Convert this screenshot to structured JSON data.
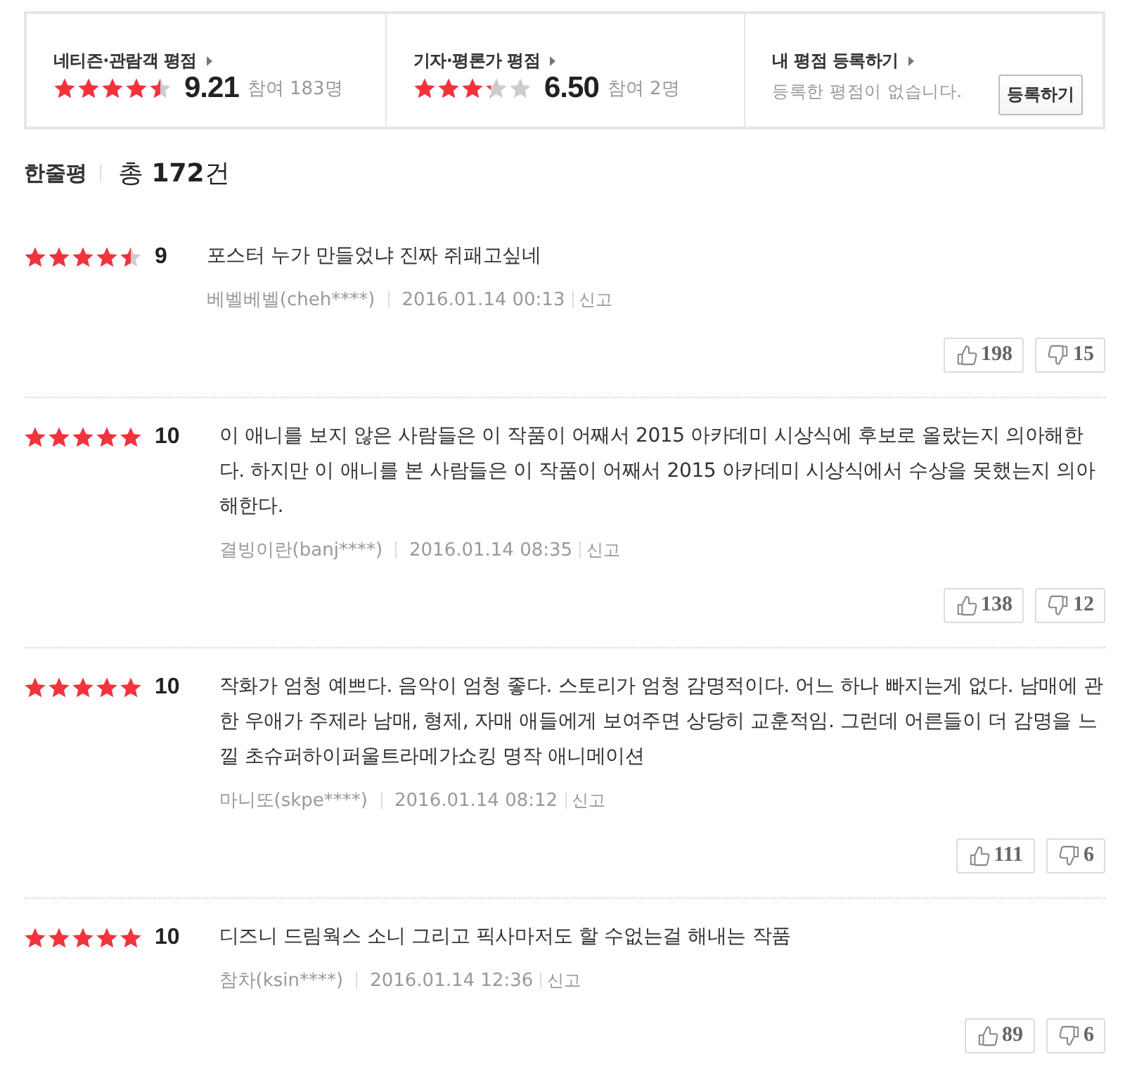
{
  "rating_summary": [
    {
      "kind": "score",
      "title": "네티즌·관람객 평점",
      "stars": 4.5,
      "score": "9.21",
      "participants": "참여 183명"
    },
    {
      "kind": "score",
      "title": "기자·평론가 평점",
      "stars": 3.25,
      "score": "6.50",
      "participants": "참여 2명"
    },
    {
      "kind": "register",
      "title": "내 평점 등록하기",
      "message": "등록한 평점이 없습니다.",
      "button": "등록하기"
    }
  ],
  "section": {
    "title": "한줄평",
    "total": "총 **172**건"
  },
  "reviews": [
    {
      "stars": 4.5,
      "score": "9",
      "text": "포스터 누가 만들었냐 진짜 쥐패고싶네",
      "author": "베벨베벨(cheh****)",
      "date": "2016.01.14 00:13",
      "report": "신고",
      "likes": "198",
      "dislikes": "15"
    },
    {
      "stars": 5,
      "score": "10",
      "text": "이 애니를 보지 않은 사람들은 이 작품이 어째서 2015 아카데미 시상식에 후보로 올랐는지 의아해한다. 하지만 이 애니를 본 사람들은 이 작품이 어째서 2015 아카데미 시상식에서 수상을 못했는지 의아해한다.",
      "author": "결빙이란(banj****)",
      "date": "2016.01.14 08:35",
      "report": "신고",
      "likes": "138",
      "dislikes": "12"
    },
    {
      "stars": 5,
      "score": "10",
      "text": "작화가 엄청 예쁘다. 음악이 엄청 좋다. 스토리가 엄청 감명적이다. 어느 하나 빠지는게 없다. 남매에 관한 우애가 주제라 남매, 형제, 자매 애들에게 보여주면 상당히 교훈적임. 그런데 어른들이 더 감명을 느낄 초슈퍼하이퍼울트라메가쇼킹 명작 애니메이션",
      "author": "마니또(skpe****)",
      "date": "2016.01.14 08:12",
      "report": "신고",
      "likes": "111",
      "dislikes": "6"
    },
    {
      "stars": 5,
      "score": "10",
      "text": "디즈니 드림웍스 소니 그리고 픽사마저도 할 수없는걸 해내는 작품",
      "author": "참차(ksin****)",
      "date": "2016.01.14 12:36",
      "report": "신고",
      "likes": "89",
      "dislikes": "6"
    }
  ]
}
